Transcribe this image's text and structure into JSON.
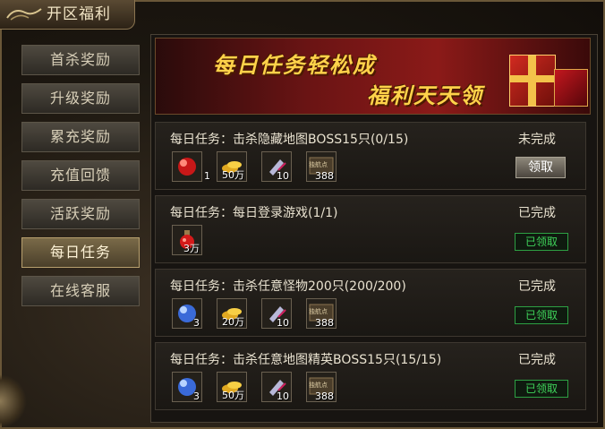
{
  "window": {
    "title": "开区福利"
  },
  "sidebar": {
    "items": [
      {
        "label": "首杀奖励"
      },
      {
        "label": "升级奖励"
      },
      {
        "label": "累充奖励"
      },
      {
        "label": "充值回馈"
      },
      {
        "label": "活跃奖励"
      },
      {
        "label": "每日任务"
      },
      {
        "label": "在线客服"
      }
    ],
    "active_index": 5
  },
  "banner": {
    "line1": "每日任务轻松成",
    "line2": "福利天天领"
  },
  "tasks": [
    {
      "title": "每日任务：击杀隐藏地图BOSS15只(0/15)",
      "status": "未完成",
      "action": "领取",
      "claimed": false,
      "rewards": [
        {
          "icon": "red-orb-icon",
          "count": "1"
        },
        {
          "icon": "gold-ingot-icon",
          "count": "50万"
        },
        {
          "icon": "scroll-icon",
          "count": "10"
        },
        {
          "icon": "token-card-icon",
          "count": "388",
          "label": "独航点"
        }
      ]
    },
    {
      "title": "每日任务：每日登录游戏(1/1)",
      "status": "已完成",
      "action": "已领取",
      "claimed": true,
      "rewards": [
        {
          "icon": "red-potion-icon",
          "count": "3万"
        }
      ]
    },
    {
      "title": "每日任务：击杀任意怪物200只(200/200)",
      "status": "已完成",
      "action": "已领取",
      "claimed": true,
      "rewards": [
        {
          "icon": "blue-orb-icon",
          "count": "3"
        },
        {
          "icon": "gold-ingot-icon",
          "count": "20万"
        },
        {
          "icon": "scroll-icon",
          "count": "10"
        },
        {
          "icon": "token-card-icon",
          "count": "388",
          "label": "独航点"
        }
      ]
    },
    {
      "title": "每日任务：击杀任意地图精英BOSS15只(15/15)",
      "status": "已完成",
      "action": "已领取",
      "claimed": true,
      "rewards": [
        {
          "icon": "blue-orb-icon",
          "count": "3"
        },
        {
          "icon": "gold-ingot-icon",
          "count": "50万"
        },
        {
          "icon": "scroll-icon",
          "count": "10"
        },
        {
          "icon": "token-card-icon",
          "count": "388",
          "label": "独航点"
        }
      ]
    }
  ],
  "colors": {
    "accent_gold": "#ffd24a",
    "claimed_green": "#3fd35a",
    "banner_red": "#8b1a18"
  }
}
